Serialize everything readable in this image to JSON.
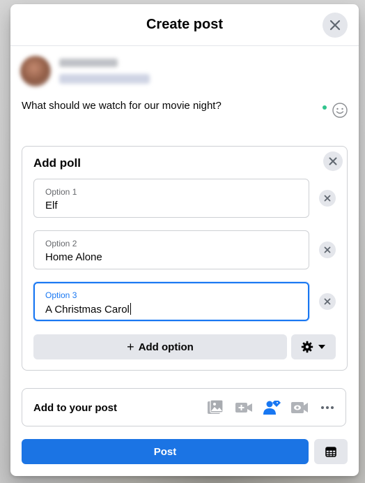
{
  "dialog": {
    "title": "Create post",
    "close_icon": "close-icon"
  },
  "composer": {
    "text": "What should we watch for our movie night?",
    "emoji_icon": "smiley-icon"
  },
  "poll": {
    "title": "Add poll",
    "options": [
      {
        "label": "Option 1",
        "value": "Elf"
      },
      {
        "label": "Option 2",
        "value": "Home Alone"
      },
      {
        "label": "Option 3",
        "value": "A Christmas Carol",
        "focused": true
      }
    ],
    "add_option_label": "Add option",
    "settings_icon": "gear-icon"
  },
  "add_to_post": {
    "label": "Add to your post",
    "icons": [
      "photo-video-icon",
      "video-camera-plus-icon",
      "tag-people-icon",
      "live-video-icon",
      "more-icon"
    ]
  },
  "footer": {
    "post_label": "Post",
    "schedule_icon": "calendar-icon"
  },
  "colors": {
    "accent": "#1b74e4",
    "focus_border": "#1877f2",
    "status_dot": "#31c48d"
  }
}
